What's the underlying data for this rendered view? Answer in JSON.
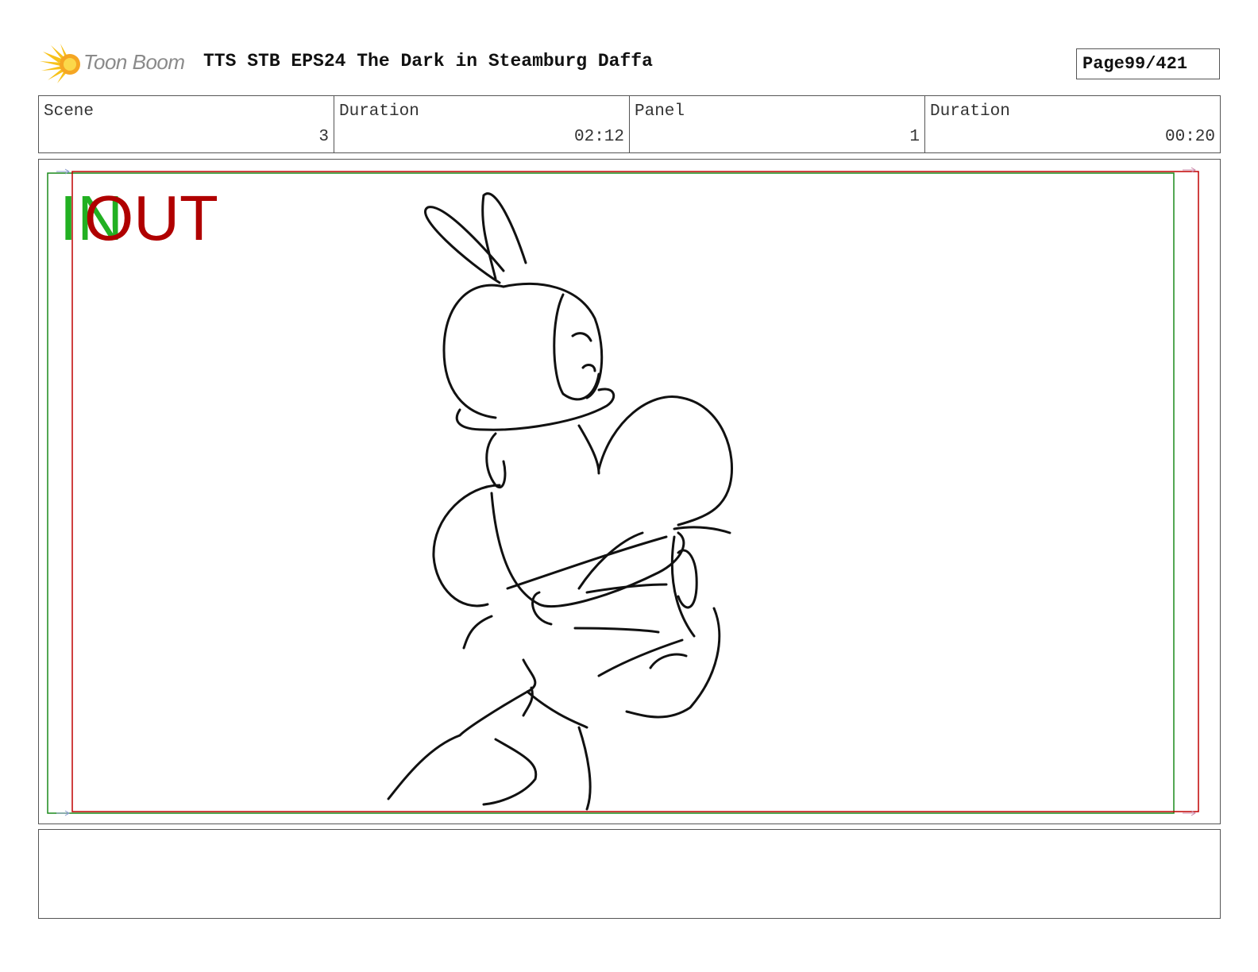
{
  "header": {
    "logo_text": "Toon Boom",
    "title": "TTS STB EPS24 The Dark in Steamburg Daffa",
    "page_label": "Page",
    "page_number": "99/421"
  },
  "info": {
    "scene_label": "Scene",
    "scene_value": "3",
    "scene_duration_label": "Duration",
    "scene_duration_value": "02:12",
    "panel_label": "Panel",
    "panel_value": "1",
    "panel_duration_label": "Duration",
    "panel_duration_value": "00:20"
  },
  "panel": {
    "in_label": "IN",
    "out_label": "OUT",
    "in_frame_color": "#1a8a1a",
    "out_frame_color": "#c00000"
  },
  "notes": {
    "text": ""
  },
  "icons": [
    "toon-boom-starburst-icon"
  ]
}
